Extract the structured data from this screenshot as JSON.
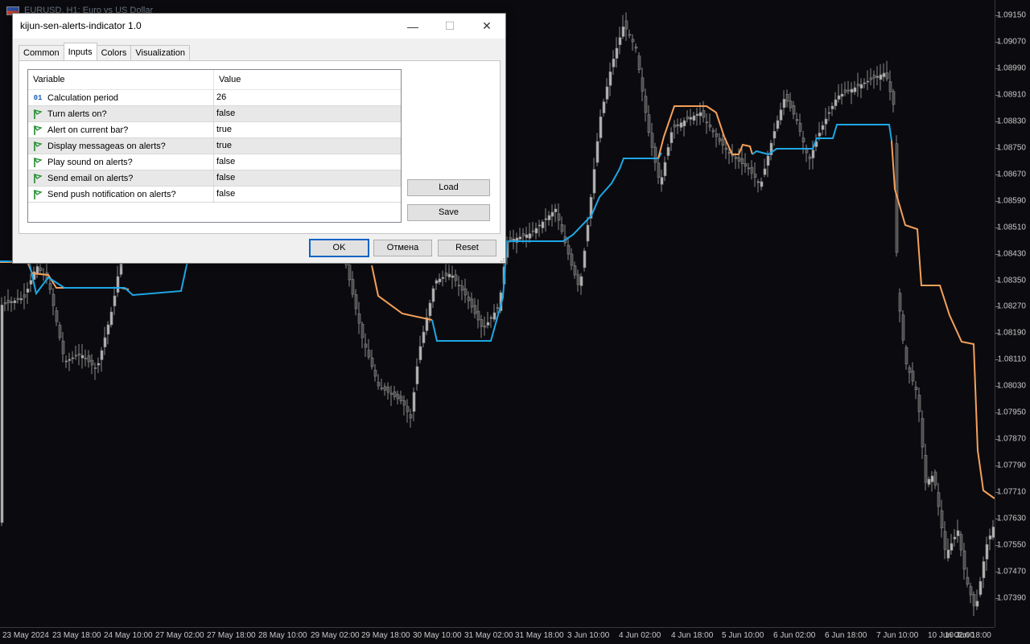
{
  "chart": {
    "symbol_label": "EURUSD, H1:  Euro vs US Dollar",
    "colors": {
      "background": "#0b0b0f",
      "candles": "#8a8a8a",
      "kijun_up": "#1ea7e6",
      "kijun_down": "#f5a05a"
    },
    "price_axis": [
      "1.09150",
      "1.09070",
      "1.08990",
      "1.08910",
      "1.08830",
      "1.08750",
      "1.08670",
      "1.08590",
      "1.08510",
      "1.08430",
      "1.08350",
      "1.08270",
      "1.08190",
      "1.08110",
      "1.08030",
      "1.07950",
      "1.07870",
      "1.07790",
      "1.07710",
      "1.07630",
      "1.07550",
      "1.07470",
      "1.07390"
    ],
    "time_axis": [
      "23 May 2024",
      "23 May 18:00",
      "24 May 10:00",
      "27 May 02:00",
      "27 May 18:00",
      "28 May 10:00",
      "29 May 02:00",
      "29 May 18:00",
      "30 May 10:00",
      "31 May 02:00",
      "31 May 18:00",
      "3 Jun 10:00",
      "4 Jun 02:00",
      "4 Jun 18:00",
      "5 Jun 10:00",
      "6 Jun 02:00",
      "6 Jun 18:00",
      "7 Jun 10:00",
      "10 Jun 02:00",
      "10 Jun 18:00"
    ]
  },
  "dialog": {
    "title": "kijun-sen-alerts-indicator 1.0",
    "window_controls": {
      "minimize": "—",
      "maximize": "☐",
      "close": "✕"
    },
    "tabs": [
      {
        "label": "Common",
        "active": false
      },
      {
        "label": "Inputs",
        "active": true
      },
      {
        "label": "Colors",
        "active": false
      },
      {
        "label": "Visualization",
        "active": false
      }
    ],
    "grid": {
      "headers": {
        "variable": "Variable",
        "value": "Value"
      },
      "rows": [
        {
          "icon": "integer-icon",
          "icon_text": "01",
          "variable": "Calculation period",
          "value": "26"
        },
        {
          "icon": "bool-flag-icon",
          "variable": "Turn alerts on?",
          "value": "false"
        },
        {
          "icon": "bool-flag-icon",
          "variable": "Alert on current bar?",
          "value": "true"
        },
        {
          "icon": "bool-flag-icon",
          "variable": "Display messageas on alerts?",
          "value": "true"
        },
        {
          "icon": "bool-flag-icon",
          "variable": "Play sound on alerts?",
          "value": "false"
        },
        {
          "icon": "bool-flag-icon",
          "variable": "Send email on alerts?",
          "value": "false"
        },
        {
          "icon": "bool-flag-icon",
          "variable": "Send push notification on alerts?",
          "value": "false"
        }
      ]
    },
    "buttons": {
      "load": "Load",
      "save": "Save",
      "ok": "OK",
      "cancel": "Отмена",
      "reset": "Reset"
    }
  }
}
